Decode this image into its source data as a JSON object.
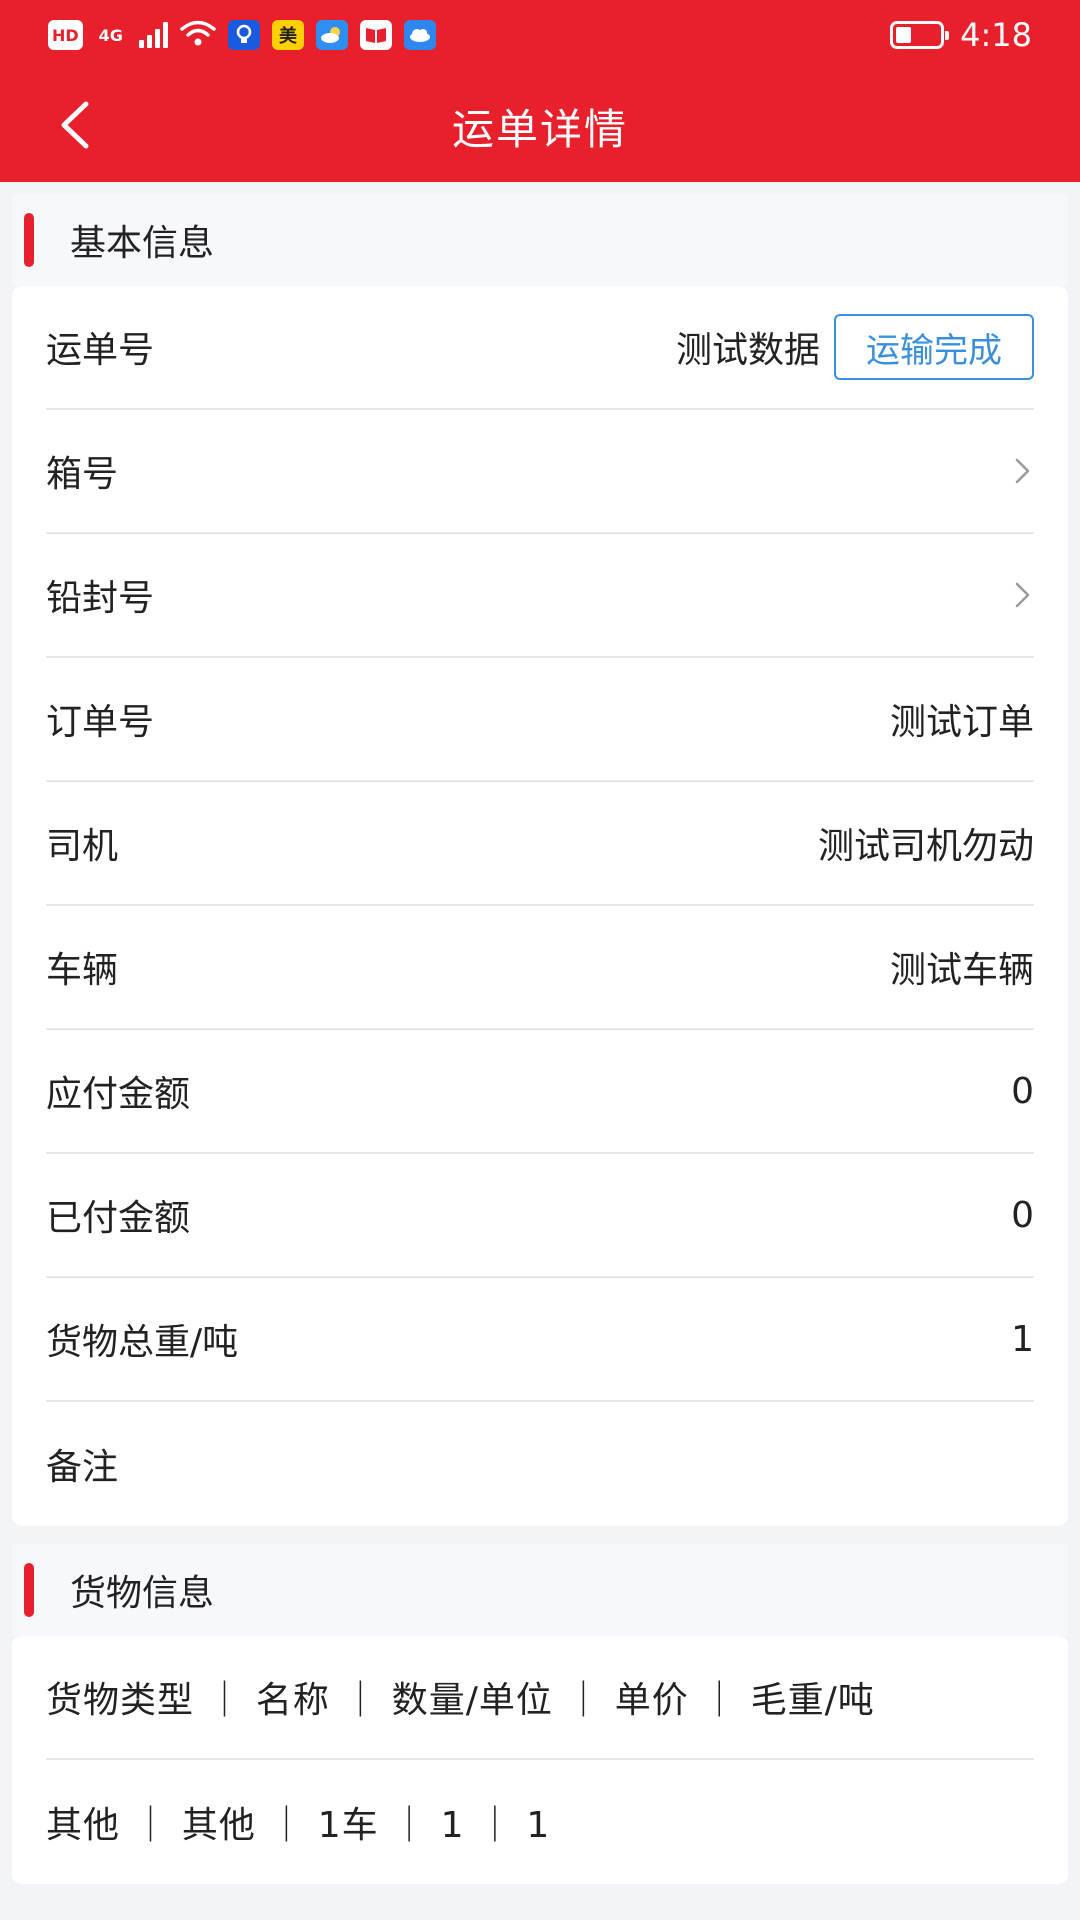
{
  "status_bar": {
    "hd": "HD",
    "network": "4G",
    "app_icons": [
      "美"
    ],
    "time": "4:18",
    "battery_level": 0.35
  },
  "header": {
    "title": "运单详情",
    "back_icon": "chevron-left-icon"
  },
  "basic_info": {
    "title": "基本信息",
    "rows": [
      {
        "label": "运单号",
        "value": "测试数据",
        "status": "运输完成"
      },
      {
        "label": "箱号",
        "value": "",
        "icon": "chevron-right-icon"
      },
      {
        "label": "铅封号",
        "value": "",
        "icon": "chevron-right-icon"
      },
      {
        "label": "订单号",
        "value": "测试订单"
      },
      {
        "label": "司机",
        "value": "测试司机勿动"
      },
      {
        "label": "车辆",
        "value": "测试车辆"
      },
      {
        "label": "应付金额",
        "value": "0"
      },
      {
        "label": "已付金额",
        "value": "0"
      },
      {
        "label": "货物总重/吨",
        "value": "1"
      },
      {
        "label": "备注",
        "value": ""
      }
    ]
  },
  "goods_info": {
    "title": "货物信息",
    "header_row": "货物类型 ｜ 名称 ｜ 数量/单位 ｜ 单价 ｜ 毛重/吨",
    "rows": [
      "其他 ｜ 其他 ｜ 1车 ｜ 1 ｜ 1"
    ]
  },
  "colors": {
    "brand_red": "#e8202b",
    "status_blue": "#3a8fdc"
  }
}
